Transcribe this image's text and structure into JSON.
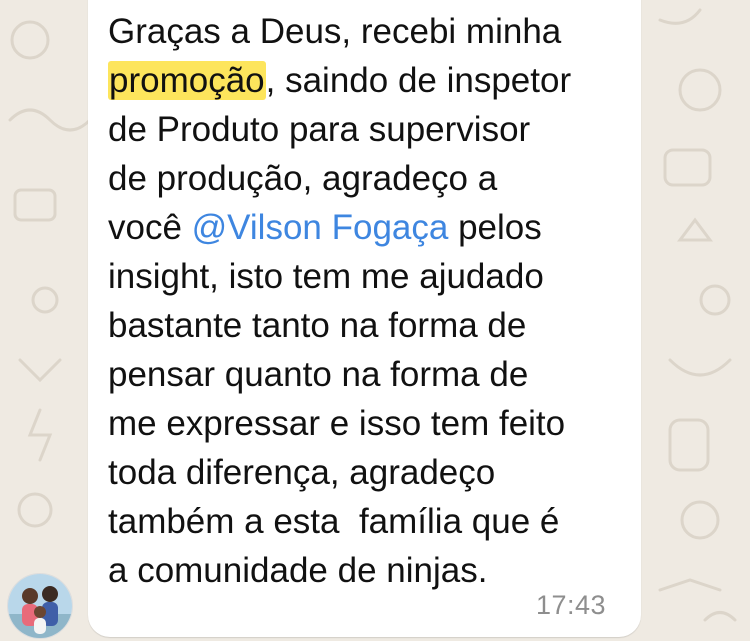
{
  "message": {
    "lines": [
      {
        "before": "Graças a Deus, recebi minha",
        "highlight": "",
        "mention": "",
        "after": ""
      },
      {
        "before": "",
        "highlight": "promoção",
        "mention": "",
        "after": ", saindo de inspetor"
      },
      {
        "before": "de Produto para supervisor",
        "highlight": "",
        "mention": "",
        "after": ""
      },
      {
        "before": "de produção, agradeço a",
        "highlight": "",
        "mention": "",
        "after": ""
      },
      {
        "before": "você ",
        "highlight": "",
        "mention": "@Vilson Fogaça",
        "after": " pelos"
      },
      {
        "before": "insight, isto tem me ajudado",
        "highlight": "",
        "mention": "",
        "after": ""
      },
      {
        "before": "bastante tanto na forma de",
        "highlight": "",
        "mention": "",
        "after": ""
      },
      {
        "before": "pensar quanto na forma de",
        "highlight": "",
        "mention": "",
        "after": ""
      },
      {
        "before": "me expressar e isso tem feito",
        "highlight": "",
        "mention": "",
        "after": ""
      },
      {
        "before": "toda diferença, agradeço",
        "highlight": "",
        "mention": "",
        "after": ""
      },
      {
        "before": "também a esta  família que é",
        "highlight": "",
        "mention": "",
        "after": ""
      },
      {
        "before": "a comunidade de ninjas.",
        "highlight": "",
        "mention": "",
        "after": ""
      }
    ],
    "timestamp": "17:43"
  },
  "colors": {
    "wallpaper": "#efeae2",
    "bubble": "#ffffff",
    "highlight": "#fde55c",
    "mention": "#3e86e0",
    "timestamp": "#8e8e8e"
  },
  "icons": {
    "avatar": "profile-photo-avatar"
  }
}
